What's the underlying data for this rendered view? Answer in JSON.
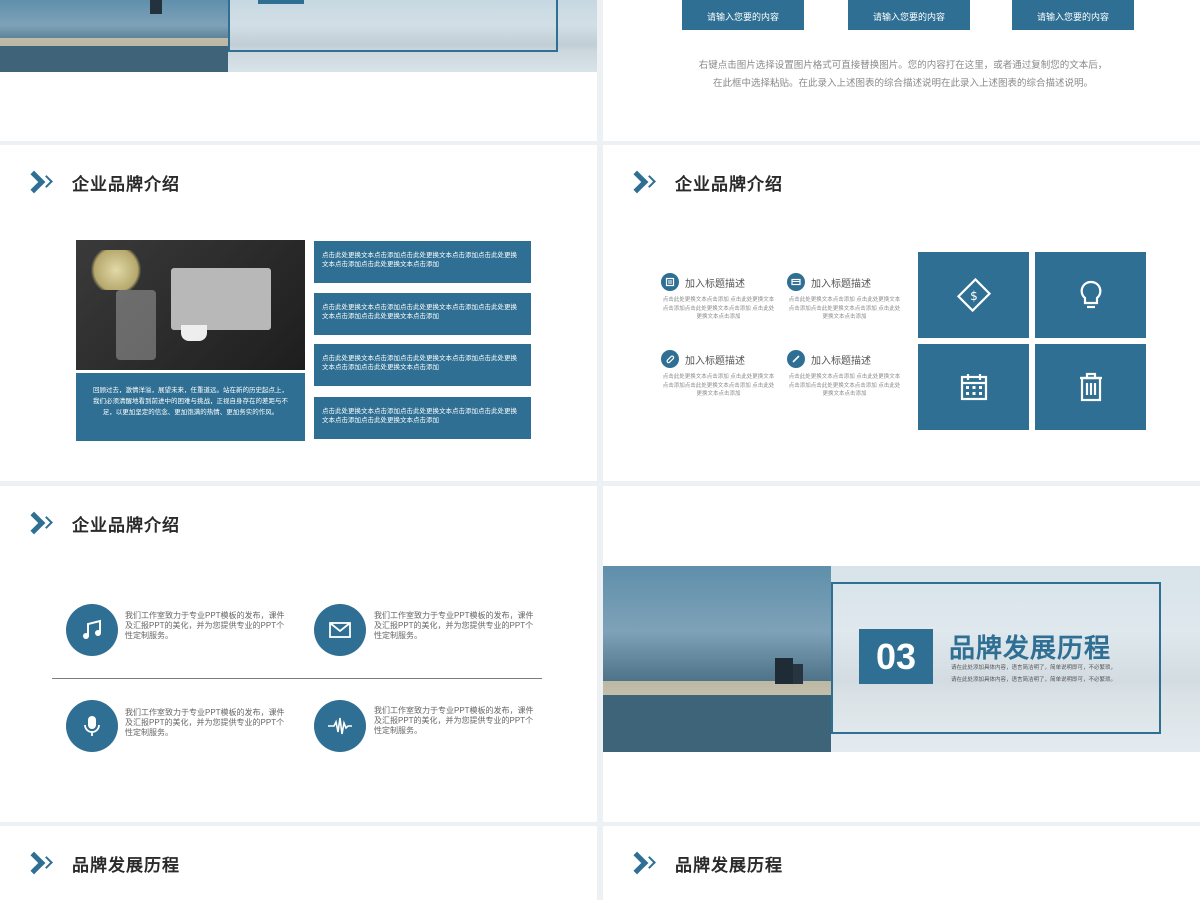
{
  "slide1": {
    "visible": "top cropped city photo slide"
  },
  "slide2": {
    "boxes": [
      "请输入您要的内容",
      "请输入您要的内容",
      "请输入您要的内容"
    ],
    "caption_line1": "右键点击图片选择设置图片格式可直接替换图片。您的内容打在这里，或者通过复制您的文本后，",
    "caption_line2": "在此框中选择粘贴。在此录入上述图表的综合描述说明在此录入上述图表的综合描述说明。"
  },
  "slide3": {
    "heading": "企业品牌介绍",
    "photo_caption": "回顾过去，激情洋溢，展望未来，任重道远。站在新的历史起点上，我们必须清醒地看到前进中的困难与挑战，正视自身存在的差距与不足，以更加坚定的信念、更加饱满的热情、更加务实的作风。",
    "items": [
      "点击此处更换文本点击添加点击此处更换文本点击添加点击此处更换文本点击添加点击此处更换文本点击添加",
      "点击此处更换文本点击添加点击此处更换文本点击添加点击此处更换文本点击添加点击此处更换文本点击添加",
      "点击此处更换文本点击添加点击此处更换文本点击添加点击此处更换文本点击添加点击此处更换文本点击添加",
      "点击此处更换文本点击添加点击此处更换文本点击添加点击此处更换文本点击添加点击此处更换文本点击添加"
    ]
  },
  "slide4": {
    "heading": "企业品牌介绍",
    "features": [
      {
        "title": "加入标题描述",
        "desc": "点击此处更换文本点击添加 点击此处更换文本点击添加点击此处更换文本点击添加 点击此处更换文本点击添加",
        "icon": "list-icon"
      },
      {
        "title": "加入标题描述",
        "desc": "点击此处更换文本点击添加 点击此处更换文本点击添加点击此处更换文本点击添加 点击此处更换文本点击添加",
        "icon": "card-icon"
      },
      {
        "title": "加入标题描述",
        "desc": "点击此处更换文本点击添加 点击此处更换文本点击添加点击此处更换文本点击添加 点击此处更换文本点击添加",
        "icon": "link-icon"
      },
      {
        "title": "加入标题描述",
        "desc": "点击此处更换文本点击添加 点击此处更换文本点击添加点击此处更换文本点击添加 点击此处更换文本点击添加",
        "icon": "pencil-icon"
      }
    ],
    "tiles": [
      "money-icon",
      "bulb-icon",
      "calendar-icon",
      "trash-icon"
    ]
  },
  "slide5": {
    "heading": "企业品牌介绍",
    "items": [
      {
        "icon": "music-icon",
        "text": "我们工作室致力于专业PPT模板的发布，课件及汇报PPT的美化，并为您提供专业的PPT个性定制服务。"
      },
      {
        "icon": "mail-icon",
        "text": "我们工作室致力于专业PPT模板的发布，课件及汇报PPT的美化，并为您提供专业的PPT个性定制服务。"
      },
      {
        "icon": "mic-icon",
        "text": "我们工作室致力于专业PPT模板的发布，课件及汇报PPT的美化，并为您提供专业的PPT个性定制服务。"
      },
      {
        "icon": "wave-icon",
        "text": "我们工作室致力于专业PPT模板的发布，课件及汇报PPT的美化，并为您提供专业的PPT个性定制服务。"
      }
    ]
  },
  "slide6": {
    "number": "03",
    "title": "品牌发展历程",
    "sub_line1": "请在此处添加具体内容，语言简洁明了，简单说明即可，不必繁琐，",
    "sub_line2": "请在此处添加具体内容，语言简洁明了，简单说明即可，不必繁琐。"
  },
  "slide7": {
    "heading": "品牌发展历程"
  },
  "slide8": {
    "heading": "品牌发展历程"
  },
  "colors": {
    "accent": "#2e6f93",
    "text": "#2a2a2a",
    "gray": "#8a8a8a"
  }
}
